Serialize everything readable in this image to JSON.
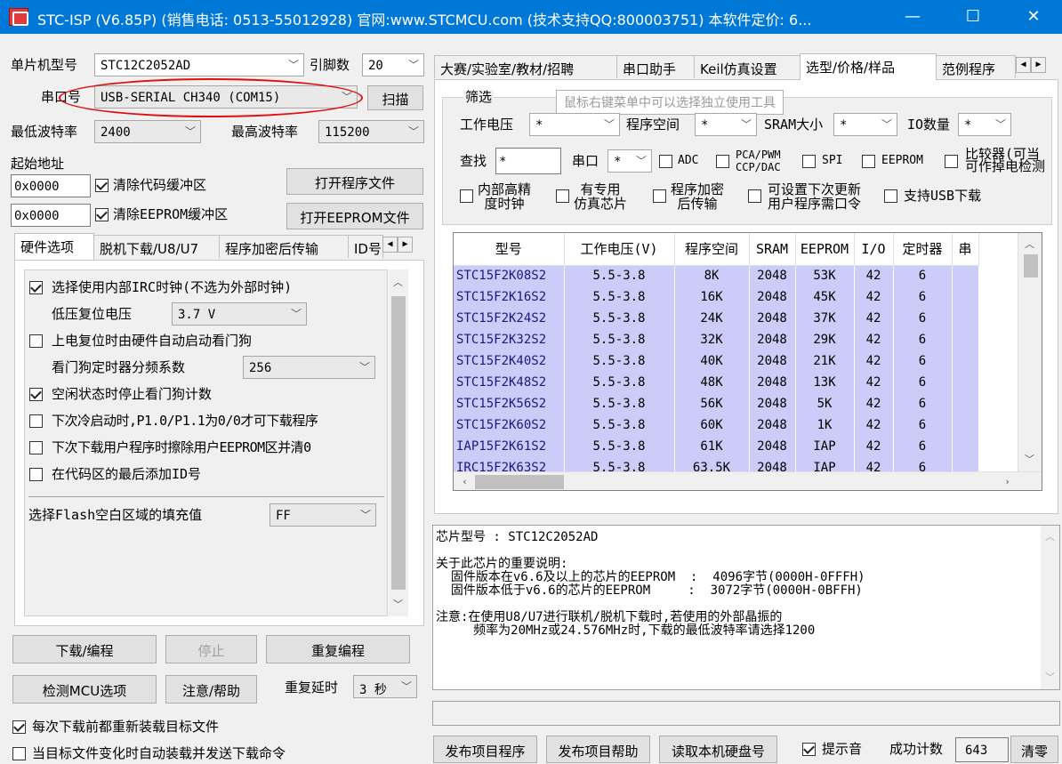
{
  "window": {
    "title": "STC-ISP (V6.85P) (销售电话: 0513-55012928) 官网:www.STCMCU.com  (技术支持QQ:800003751) 本软件定价: 6...",
    "minimize": "—",
    "maximize": "☐",
    "close": "✕"
  },
  "left": {
    "mcu_label": "单片机型号",
    "mcu_value": "STC12C2052AD",
    "pins_label": "引脚数",
    "pins_value": "20",
    "port_label": "串口号",
    "port_value": "USB-SERIAL CH340 (COM15)",
    "scan_button": "扫描",
    "min_baud_label": "最低波特率",
    "min_baud_value": "2400",
    "max_baud_label": "最高波特率",
    "max_baud_value": "115200",
    "start_addr_label": "起始地址",
    "code_addr": "0x0000",
    "clear_code": "清除代码缓冲区",
    "open_program": "打开程序文件",
    "eeprom_addr": "0x0000",
    "clear_eeprom": "清除EEPROM缓冲区",
    "open_eeprom": "打开EEPROM文件"
  },
  "hw_tabs": [
    "硬件选项",
    "脱机下载/U8/U7",
    "程序加密后传输",
    "ID号"
  ],
  "hw_options": {
    "irc": "选择使用内部IRC时钟(不选为外部时钟)",
    "low_reset_label": "低压复位电压",
    "low_reset_value": "3.7 V",
    "watchdog": "上电复位时由硬件自动启动看门狗",
    "wdt_div_label": "看门狗定时器分频系数",
    "wdt_div_value": "256",
    "idle_stop": "空闲状态时停止看门狗计数",
    "cold_boot": "下次冷启动时,P1.0/P1.1为0/0才可下载程序",
    "erase_eeprom": "下次下载用户程序时擦除用户EEPROM区并清0",
    "add_id": "在代码区的最后添加ID号",
    "fill_label": "选择Flash空白区域的填充值",
    "fill_value": "FF"
  },
  "actions": {
    "download": "下载/编程",
    "stop": "停止",
    "reprogram": "重复编程",
    "check_mcu": "检测MCU选项",
    "help": "注意/帮助",
    "delay_label": "重复延时",
    "delay_value": "3 秒",
    "reload": "每次下载前都重新装载目标文件",
    "auto_load": "当目标文件变化时自动装载并发送下载命令"
  },
  "right_tabs": [
    "大赛/实验室/教材/招聘",
    "串口助手",
    "Keil仿真设置",
    "选型/价格/样品",
    "范例程序"
  ],
  "filter": {
    "group_label": "筛选",
    "tooltip": "鼠标右键菜单中可以选择独立使用工具",
    "voltage_label": "工作电压",
    "voltage_value": "*",
    "prog_space_label": "程序空间",
    "prog_space_value": "*",
    "sram_label": "SRAM大小",
    "sram_value": "*",
    "io_label": "IO数量",
    "io_value": "*",
    "search_label": "查找",
    "search_value": "*",
    "uart_label": "串口",
    "uart_value": "*",
    "adc": "ADC",
    "pca": "PCA/PWM\nCCP/DAC",
    "spi": "SPI",
    "eeprom": "EEPROM",
    "comparator": "比较器(可当\n可作掉电检测",
    "irc_hp": "内部高精\n度时钟",
    "emulator": "有专用\n仿真芯片",
    "encrypt": "程序加密\n后传输",
    "update_pwd": "可设置下次更新\n用户程序需口令",
    "usb": "支持USB下载"
  },
  "table": {
    "headers": [
      "型号",
      "工作电压(V)",
      "程序空间",
      "SRAM",
      "EEPROM",
      "I/O",
      "定时器",
      "串"
    ],
    "rows": [
      [
        "STC15F2K08S2",
        "5.5-3.8",
        "8K",
        "2048",
        "53K",
        "42",
        "6"
      ],
      [
        "STC15F2K16S2",
        "5.5-3.8",
        "16K",
        "2048",
        "45K",
        "42",
        "6"
      ],
      [
        "STC15F2K24S2",
        "5.5-3.8",
        "24K",
        "2048",
        "37K",
        "42",
        "6"
      ],
      [
        "STC15F2K32S2",
        "5.5-3.8",
        "32K",
        "2048",
        "29K",
        "42",
        "6"
      ],
      [
        "STC15F2K40S2",
        "5.5-3.8",
        "40K",
        "2048",
        "21K",
        "42",
        "6"
      ],
      [
        "STC15F2K48S2",
        "5.5-3.8",
        "48K",
        "2048",
        "13K",
        "42",
        "6"
      ],
      [
        "STC15F2K56S2",
        "5.5-3.8",
        "56K",
        "2048",
        "5K",
        "42",
        "6"
      ],
      [
        "STC15F2K60S2",
        "5.5-3.8",
        "60K",
        "2048",
        "1K",
        "42",
        "6"
      ],
      [
        "IAP15F2K61S2",
        "5.5-3.8",
        "61K",
        "2048",
        "IAP",
        "42",
        "6"
      ],
      [
        "IRC15F2K63S2",
        "5.5-3.8",
        "63.5K",
        "2048",
        "IAP",
        "42",
        "6"
      ]
    ]
  },
  "info": {
    "text": "芯片型号 : STC12C2052AD\n\n关于此芯片的重要说明:\n  固件版本在v6.6及以上的芯片的EEPROM  :  4096字节(0000H-0FFFH)\n  固件版本低于v6.6的芯片的EEPROM     :  3072字节(0000H-0BFFH)\n\n注意:在使用U8/U7进行联机/脱机下载时,若使用的外部晶振的\n     频率为20MHz或24.576MHz时,下载的最低波特率请选择1200"
  },
  "bottom": {
    "publish_program": "发布项目程序",
    "publish_help": "发布项目帮助",
    "read_disk": "读取本机硬盘号",
    "beep": "提示音",
    "success_label": "成功计数",
    "success_value": "643",
    "clear": "清零"
  },
  "colors": {
    "titlebar": "#0078d7",
    "row_highlight": "#ccccf8",
    "annotation": "#e01010"
  }
}
